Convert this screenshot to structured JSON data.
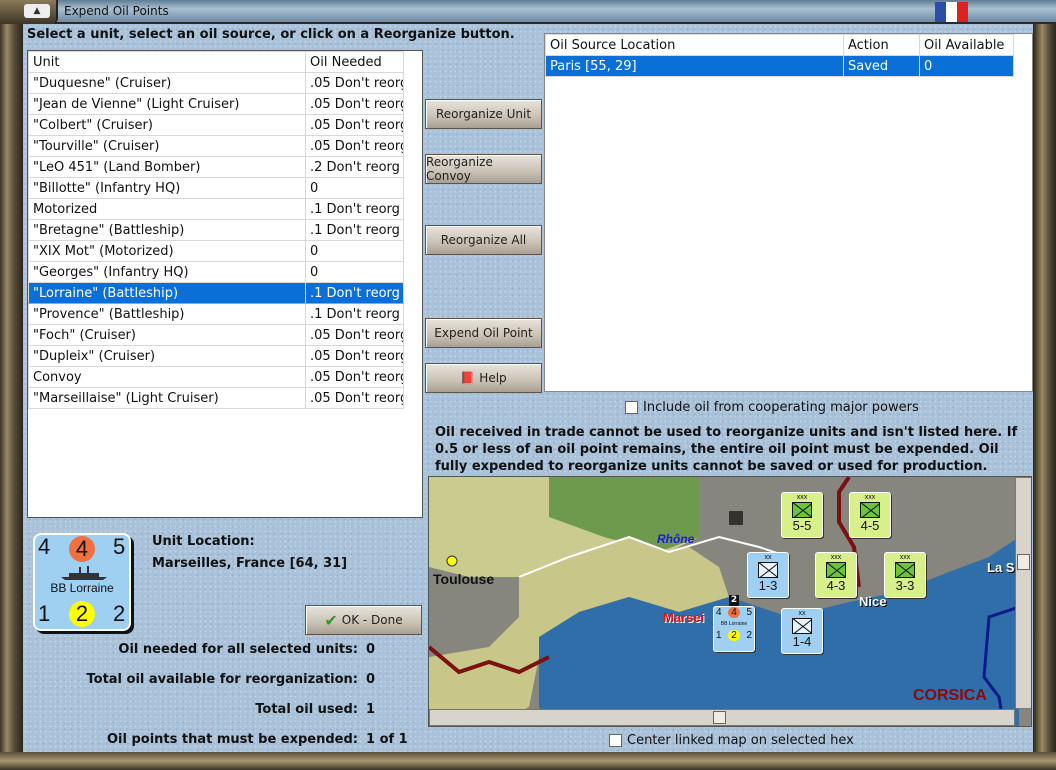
{
  "window": {
    "title": "Expend Oil Points"
  },
  "instruction": "Select a unit, select an oil source, or click on a Reorganize button.",
  "units_table": {
    "headers": [
      "Unit",
      "Oil Needed"
    ],
    "rows": [
      [
        "\"Duquesne\" (Cruiser)",
        ".05 Don't reorg"
      ],
      [
        "\"Jean de Vienne\" (Light Cruiser)",
        ".05 Don't reorg"
      ],
      [
        "\"Colbert\" (Cruiser)",
        ".05 Don't reorg"
      ],
      [
        "\"Tourville\" (Cruiser)",
        ".05 Don't reorg"
      ],
      [
        "\"LeO 451\" (Land Bomber)",
        ".2 Don't reorg"
      ],
      [
        "\"Billotte\" (Infantry HQ)",
        "0"
      ],
      [
        "Motorized",
        ".1 Don't reorg"
      ],
      [
        "\"Bretagne\" (Battleship)",
        ".1 Don't reorg"
      ],
      [
        "\"XIX Mot\" (Motorized)",
        "0"
      ],
      [
        "\"Georges\" (Infantry HQ)",
        "0"
      ],
      [
        "\"Lorraine\" (Battleship)",
        ".1 Don't reorg"
      ],
      [
        "\"Provence\" (Battleship)",
        ".1 Don't reorg"
      ],
      [
        "\"Foch\" (Cruiser)",
        ".05 Don't reorg"
      ],
      [
        "\"Dupleix\" (Cruiser)",
        ".05 Don't reorg"
      ],
      [
        "Convoy",
        ".05 Don't reorg"
      ],
      [
        "\"Marseillaise\" (Light Cruiser)",
        ".05 Don't reorg"
      ]
    ],
    "selected_index": 10
  },
  "buttons": {
    "reorganize_unit": "Reorganize Unit",
    "reorganize_convoy": "Reorganize Convoy",
    "reorganize_all": "Reorganize All",
    "expend_oil_point": "Expend Oil Point",
    "help": "Help",
    "ok_done": "OK - Done"
  },
  "source_table": {
    "headers": [
      "Oil Source Location",
      "Action",
      "Oil Available"
    ],
    "rows": [
      [
        "Paris [55, 29]",
        "Saved",
        "0"
      ]
    ]
  },
  "include_cooperating": {
    "label": "Include oil from cooperating major powers",
    "checked": false
  },
  "notice": "Oil received in trade cannot be used to reorganize units and isn't listed here.  If 0.5 or less of an oil point remains, the entire oil point must be expended.   Oil fully expended to reorganize units cannot be saved or used for production.",
  "counter": {
    "attack": "4",
    "oil": "4",
    "move": "5",
    "name": "BB Lorraine",
    "defense": "1",
    "org": "2",
    "range": "2"
  },
  "location": {
    "label": "Unit Location:",
    "value": "Marseilles, France [64, 31]"
  },
  "stats": [
    {
      "label": "Oil needed for all selected units:",
      "value": "0"
    },
    {
      "label": "Total oil available for reorganization:",
      "value": "0"
    },
    {
      "label": "Total oil used:",
      "value": "1"
    },
    {
      "label": "Oil points that must be expended:",
      "value": "1 of 1"
    }
  ],
  "map": {
    "labels": {
      "toulouse": "Toulouse",
      "rhone": "Rhône",
      "marseille": "Marsei",
      "nice": "Nice",
      "corsica": "CORSICA",
      "la": "La S"
    },
    "units": [
      {
        "size": "xxx",
        "value": "5-5"
      },
      {
        "size": "xxx",
        "value": "4-5"
      },
      {
        "size": "xx",
        "value": "1-3"
      },
      {
        "size": "xxx",
        "value": "4-3"
      },
      {
        "size": "xxx",
        "value": "3-3"
      },
      {
        "size": "xx",
        "value": "1-4"
      }
    ],
    "stack_count": "2",
    "mini_counter": {
      "attack": "4",
      "oil": "4",
      "move": "5",
      "name": "BB Lorraine",
      "defense": "1",
      "org": "2",
      "range": "2"
    }
  },
  "center_linked": {
    "label": "Center linked map on selected hex",
    "checked": false
  },
  "colors": {
    "selection": "#0a6fd6",
    "oil_circle": "#f07040",
    "org_circle": "#ffff00",
    "counter_bg": "#9fd0f2"
  }
}
